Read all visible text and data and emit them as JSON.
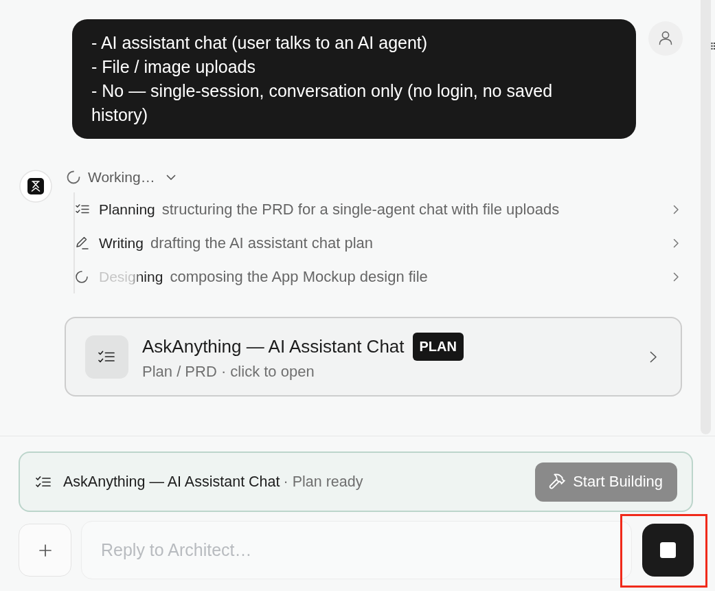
{
  "user_message": {
    "lines": [
      "- AI assistant chat (user talks to an AI agent)",
      "- File / image uploads",
      "- No — single-session, conversation only (no login, no saved history)"
    ]
  },
  "agent": {
    "status": "Working…",
    "expanded": true,
    "steps": [
      {
        "kind": "plan",
        "label": "Planning",
        "detail": "structuring the PRD for a single-agent chat with file uploads",
        "active": false
      },
      {
        "kind": "write",
        "label": "Writing",
        "detail": "drafting the AI assistant chat plan",
        "active": false
      },
      {
        "kind": "design",
        "label": "Designing",
        "detail": "composing the App Mockup design file",
        "active": true
      }
    ]
  },
  "plan_card": {
    "title": "AskAnything — AI Assistant Chat",
    "badge": "PLAN",
    "subtitle": "Plan / PRD · click to open"
  },
  "plan_ready": {
    "title": "AskAnything — AI Assistant Chat",
    "status": "· Plan ready",
    "button": {
      "label": "Start Building",
      "disabled": true
    }
  },
  "composer": {
    "placeholder": "Reply to Architect…",
    "stop_button": {
      "highlighted": true
    }
  }
}
